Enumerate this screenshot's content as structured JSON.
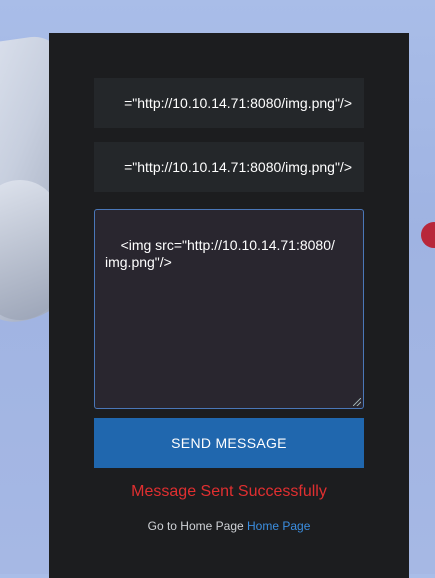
{
  "form": {
    "field1_value": "=\"http://10.10.14.71:8080/img.png\"/>",
    "field2_value": "=\"http://10.10.14.71:8080/img.png\"/>",
    "message_value": "<img src=\"http://10.10.14.71:8080/\nimg.png\"/>",
    "send_label": "SEND MESSAGE"
  },
  "status": {
    "message": "Message Sent Successfully",
    "color": "#e02f30"
  },
  "footer": {
    "prefix": "Go to Home Page",
    "link_label": "Home Page"
  },
  "colors": {
    "panel_bg": "#1c1d1f",
    "button_bg": "#2067ae",
    "link": "#3b8ee0"
  }
}
